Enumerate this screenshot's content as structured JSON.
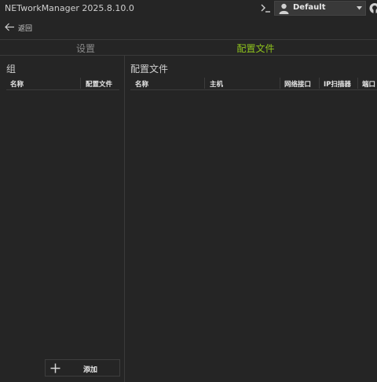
{
  "app": {
    "title": "NETworkManager 2025.8.10.0",
    "profile_selector": {
      "value": "Default",
      "icon": "user-icon"
    },
    "icons": [
      "terminal-icon",
      "github-icon"
    ]
  },
  "nav": {
    "back_label": "返回"
  },
  "tabs": [
    {
      "label": "设置",
      "active": false
    },
    {
      "label": "配置文件",
      "active": true
    }
  ],
  "groups_panel": {
    "title": "组",
    "columns": [
      "名称",
      "配置文件"
    ],
    "rows": [],
    "add_button_label": "添加"
  },
  "profiles_panel": {
    "title": "配置文件",
    "columns": [
      "名称",
      "主机",
      "网络接口",
      "IP扫描器",
      "端口"
    ],
    "rows": []
  },
  "colors": {
    "background": "#252525",
    "accent": "#8ec21d",
    "inactive_tab": "#8a8a8a",
    "divider": "#3a3a3a"
  }
}
